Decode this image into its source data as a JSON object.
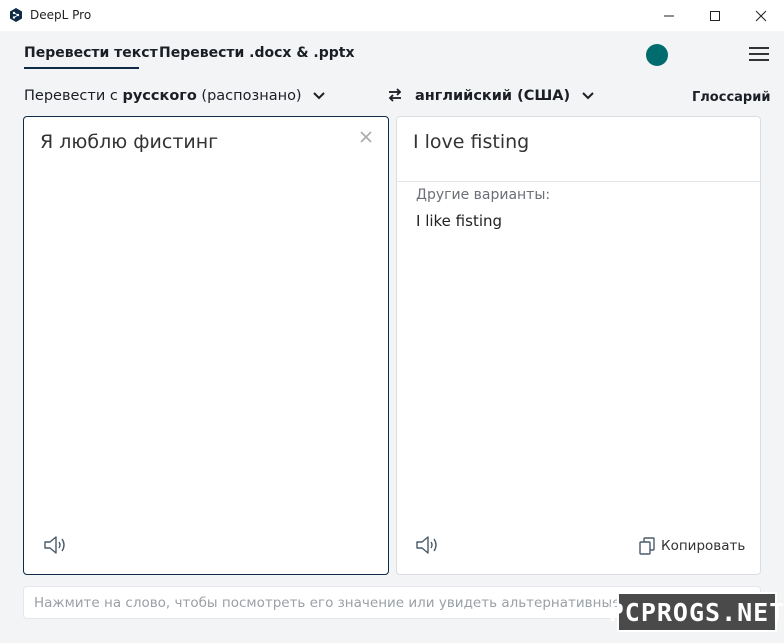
{
  "window": {
    "title": "DeepL Pro"
  },
  "tabs": [
    {
      "label": "Перевести текст",
      "active": true
    },
    {
      "label": "Перевести .docx & .pptx",
      "active": false
    }
  ],
  "languages": {
    "source_prefix": "Перевести с ",
    "source_lang": "русского",
    "source_suffix": " (распознано)",
    "target_lang": "английский (США)",
    "glossary_label": "Глоссарий"
  },
  "source": {
    "text": "Я люблю фистинг"
  },
  "target": {
    "text": "I love fisting",
    "alternatives_label": "Другие варианты:",
    "alternatives": [
      "I like fisting"
    ],
    "copy_label": "Копировать"
  },
  "hint": {
    "text": "Нажмите на слово, чтобы посмотреть его значение или увидеть альтернативные пер"
  },
  "watermark": {
    "text": "PCPROGS.NET"
  },
  "colors": {
    "accent": "#0f2b46",
    "account": "#006c6e",
    "background": "#f2f4f5"
  }
}
